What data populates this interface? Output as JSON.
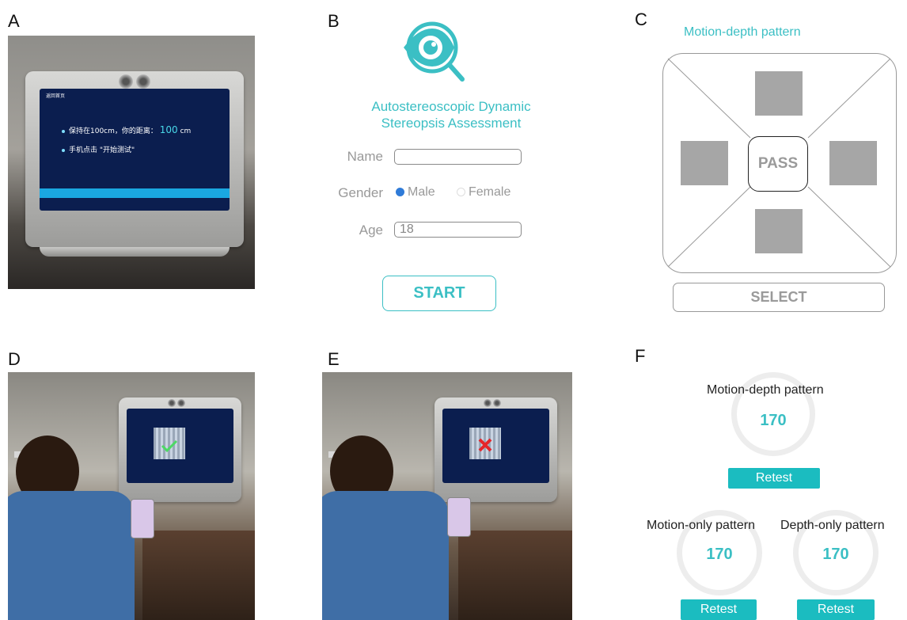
{
  "panels": {
    "a": "A",
    "b": "B",
    "c": "C",
    "d": "D",
    "e": "E",
    "f": "F"
  },
  "device_screen": {
    "line1_prefix": "保持在100cm，你的距离：",
    "line1_value": "100",
    "line1_unit": "cm",
    "line2": "手机点击 \"开始测试\"",
    "header": "返回首页"
  },
  "assessment_form": {
    "title_line1": "Autostereoscopic Dynamic",
    "title_line2": "Stereopsis Assessment",
    "name_label": "Name",
    "name_value": "",
    "gender_label": "Gender",
    "gender_options": [
      "Male",
      "Female"
    ],
    "gender_selected": "Male",
    "age_label": "Age",
    "age_value": "18",
    "start_label": "START"
  },
  "pattern_select": {
    "title": "Motion-depth pattern",
    "pass_label": "PASS",
    "select_label": "SELECT"
  },
  "results": {
    "motion_depth": {
      "label": "Motion-depth pattern",
      "score": "170",
      "retest_label": "Retest"
    },
    "motion_only": {
      "label": "Motion-only pattern",
      "score": "170",
      "retest_label": "Retest"
    },
    "depth_only": {
      "label": "Depth-only pattern",
      "score": "170",
      "retest_label": "Retest"
    }
  },
  "colors": {
    "accent": "#3bbfc4",
    "button_fill": "#1bbcc0",
    "device_screen": "#0b1e4f"
  },
  "icons": {
    "app_logo": "eye-magnifier-icon",
    "radio_selected": "radio-checked-icon",
    "radio_unselected": "radio-empty-icon"
  }
}
